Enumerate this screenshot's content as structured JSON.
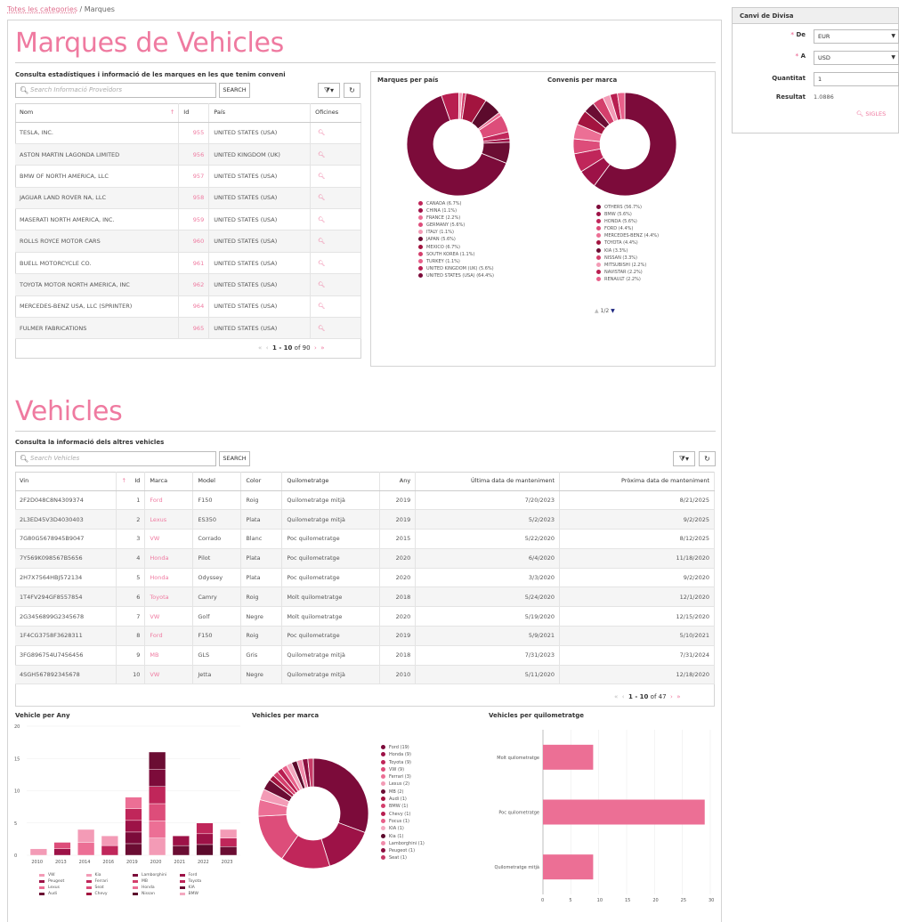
{
  "breadcrumb": {
    "link": "Totes les categories",
    "sep": " / ",
    "current": "Marques"
  },
  "brands": {
    "title": "Marques de Vehicles",
    "subtitle": "Consulta estadístiques i informació de les marques en les que tenim conveni",
    "search_placeholder": "Search Informació Proveïdors",
    "search_button": "SEARCH",
    "filter_icon": "filter-icon",
    "refresh_icon": "refresh-icon",
    "columns": [
      "Nom",
      "Id",
      "País",
      "Oficines"
    ],
    "sort_marker": "↑",
    "rows": [
      {
        "name": "TESLA, INC.",
        "id": "955",
        "country": "UNITED STATES (USA)"
      },
      {
        "name": "ASTON MARTIN LAGONDA LIMITED",
        "id": "956",
        "country": "UNITED KINGDOM (UK)"
      },
      {
        "name": "BMW OF NORTH AMERICA, LLC",
        "id": "957",
        "country": "UNITED STATES (USA)"
      },
      {
        "name": "JAGUAR LAND ROVER NA, LLC",
        "id": "958",
        "country": "UNITED STATES (USA)"
      },
      {
        "name": "MASERATI NORTH AMERICA, INC.",
        "id": "959",
        "country": "UNITED STATES (USA)"
      },
      {
        "name": "ROLLS ROYCE MOTOR CARS",
        "id": "960",
        "country": "UNITED STATES (USA)"
      },
      {
        "name": "BUELL MOTORCYCLE CO.",
        "id": "961",
        "country": "UNITED STATES (USA)"
      },
      {
        "name": "TOYOTA MOTOR NORTH AMERICA, INC",
        "id": "962",
        "country": "UNITED STATES (USA)"
      },
      {
        "name": "MERCEDES-BENZ USA, LLC (SPRINTER)",
        "id": "964",
        "country": "UNITED STATES (USA)"
      },
      {
        "name": "FULMER FABRICATIONS",
        "id": "965",
        "country": "UNITED STATES (USA)"
      }
    ],
    "pager": {
      "range": "1 - 10",
      "of": "of 90"
    },
    "pie_titles": [
      "Marques per país",
      "Convenis per marca"
    ],
    "pie_pager": "1/2"
  },
  "chart_data": [
    {
      "type": "pie",
      "title": "Marques per país",
      "series": [
        {
          "labels": [
            "CANADA (6.7%)",
            "CHINA (1.1%)",
            "FRANCE (2.2%)",
            "GERMANY (5.6%)",
            "ITALY (1.1%)",
            "JAPAN (5.6%)",
            "MEXICO (6.7%)",
            "SOUTH KOREA (1.1%)",
            "TURKEY (1.1%)",
            "UNITED KINGDOM (UK) (5.6%)",
            "UNITED STATES (USA) (64.4%)"
          ],
          "values": [
            6.7,
            1.1,
            2.2,
            5.6,
            1.1,
            5.6,
            6.7,
            1.1,
            1.1,
            5.6,
            64.4
          ]
        }
      ]
    },
    {
      "type": "pie",
      "title": "Convenis per marca",
      "series": [
        {
          "labels": [
            "OTHERS (56.7%)",
            "BMW (5.6%)",
            "HONDA (5.6%)",
            "FORD (4.4%)",
            "MERCEDES-BENZ (4.4%)",
            "TOYOTA (4.4%)",
            "KIA (3.3%)",
            "NISSAN (3.3%)",
            "MITSUBISHI (2.2%)",
            "NAVISTAR (2.2%)",
            "RENAULT (2.2%)"
          ],
          "values": [
            56.7,
            5.6,
            5.6,
            4.4,
            4.4,
            4.4,
            3.3,
            3.3,
            2.2,
            2.2,
            2.2
          ]
        }
      ]
    },
    {
      "type": "bar",
      "title": "Vehicle per Any",
      "categories": [
        "2010",
        "2013",
        "2014",
        "2016",
        "2019",
        "2020",
        "2021",
        "2022",
        "2023"
      ],
      "values": [
        1,
        2,
        4,
        3,
        9,
        16,
        3,
        5,
        4
      ],
      "ylim": [
        0,
        20
      ],
      "yticks": [
        "0",
        "5",
        "10",
        "15",
        "20"
      ],
      "legend": [
        "VW",
        "Peugeot",
        "Lexus",
        "Audi",
        "Kia",
        "Ferrari",
        "Seat",
        "Chevy",
        "Lamborghini",
        "MB",
        "Honda",
        "Nissan",
        "Ford",
        "Toyota",
        "KIA",
        "BMW"
      ]
    },
    {
      "type": "pie",
      "title": "Vehicles per marca",
      "series": [
        {
          "labels": [
            "Ford (19)",
            "Honda (9)",
            "Toyota (9)",
            "VW (9)",
            "Ferrari (3)",
            "Lexus (2)",
            "MB (2)",
            "Audi (1)",
            "BMW (1)",
            "Chevy (1)",
            "Focus (1)",
            "KIA (1)",
            "Kia (1)",
            "Lamborghini (1)",
            "Peugeot (1)",
            "Seat (1)"
          ],
          "values": [
            19,
            9,
            9,
            9,
            3,
            2,
            2,
            1,
            1,
            1,
            1,
            1,
            1,
            1,
            1,
            1
          ]
        }
      ]
    },
    {
      "type": "bar",
      "title": "Vehicles per quilometratge",
      "categories": [
        "Molt quilometratge",
        "Poc quilometratge",
        "Quilometratge mitjà"
      ],
      "values": [
        9,
        29,
        9
      ],
      "xlim": [
        0,
        30
      ],
      "xticks": [
        "0",
        "5",
        "10",
        "15",
        "20",
        "25",
        "30"
      ]
    }
  ],
  "vehicles": {
    "title": "Vehicles",
    "subtitle": "Consulta la informació dels altres vehicles",
    "search_placeholder": "Search Vehicles",
    "search_button": "SEARCH",
    "columns": [
      "Vin",
      "Id",
      "Marca",
      "Model",
      "Color",
      "Quilometratge",
      "Any",
      "Última data de manteniment",
      "Pròxima data de manteniment"
    ],
    "rows": [
      {
        "vin": "2F2D048C8N4309374",
        "id": "1",
        "brand": "Ford",
        "model": "F150",
        "color": "Roig",
        "km": "Quilometratge mitjà",
        "year": "2019",
        "last": "7/20/2023",
        "next": "8/21/2025"
      },
      {
        "vin": "2L3ED45V3D4030403",
        "id": "2",
        "brand": "Lexus",
        "model": "ES350",
        "color": "Plata",
        "km": "Quilometratge mitjà",
        "year": "2019",
        "last": "5/2/2023",
        "next": "9/2/2025"
      },
      {
        "vin": "7G80G5678945B9047",
        "id": "3",
        "brand": "VW",
        "model": "Corrado",
        "color": "Blanc",
        "km": "Poc quilometratge",
        "year": "2015",
        "last": "5/22/2020",
        "next": "8/12/2025"
      },
      {
        "vin": "7Y569K098567B5656",
        "id": "4",
        "brand": "Honda",
        "model": "Pilot",
        "color": "Plata",
        "km": "Poc quilometratge",
        "year": "2020",
        "last": "6/4/2020",
        "next": "11/18/2020"
      },
      {
        "vin": "2H7X7564HBJ572134",
        "id": "5",
        "brand": "Honda",
        "model": "Odyssey",
        "color": "Plata",
        "km": "Poc quilometratge",
        "year": "2020",
        "last": "3/3/2020",
        "next": "9/2/2020"
      },
      {
        "vin": "1T4FV294GF8557854",
        "id": "6",
        "brand": "Toyota",
        "model": "Camry",
        "color": "Roig",
        "km": "Molt quilometratge",
        "year": "2018",
        "last": "5/24/2020",
        "next": "12/1/2020"
      },
      {
        "vin": "2G3456899G2345678",
        "id": "7",
        "brand": "VW",
        "model": "Golf",
        "color": "Negre",
        "km": "Molt quilometratge",
        "year": "2020",
        "last": "5/19/2020",
        "next": "12/15/2020"
      },
      {
        "vin": "1F4CG3758F3628311",
        "id": "8",
        "brand": "Ford",
        "model": "F150",
        "color": "Roig",
        "km": "Poc quilometratge",
        "year": "2019",
        "last": "5/9/2021",
        "next": "5/10/2021"
      },
      {
        "vin": "3FG896754U7456456",
        "id": "9",
        "brand": "MB",
        "model": "GLS",
        "color": "Gris",
        "km": "Quilometratge mitjà",
        "year": "2018",
        "last": "7/31/2023",
        "next": "7/31/2024"
      },
      {
        "vin": "4SGH567892345678",
        "id": "10",
        "brand": "VW",
        "model": "Jetta",
        "color": "Negre",
        "km": "Quilometratge mitjà",
        "year": "2010",
        "last": "5/11/2020",
        "next": "12/18/2020"
      }
    ],
    "pager": {
      "range": "1 - 10",
      "of": "of 47"
    }
  },
  "converter": {
    "title": "Canvi de Divisa",
    "from_label": "De",
    "to_label": "A",
    "qty_label": "Quantitat",
    "result_label": "Resultat",
    "from_value": "EUR",
    "to_value": "USD",
    "qty_value": "1",
    "result_value": "1.0886",
    "sigles_button": "SIGLES"
  },
  "colors": {
    "accent": "#ef7aa0",
    "palette": [
      "#5c0a2c",
      "#7c0b3a",
      "#9d1247",
      "#c0265a",
      "#dd4d7a",
      "#ec6f95",
      "#f39bb6",
      "#f6b8cc"
    ]
  }
}
